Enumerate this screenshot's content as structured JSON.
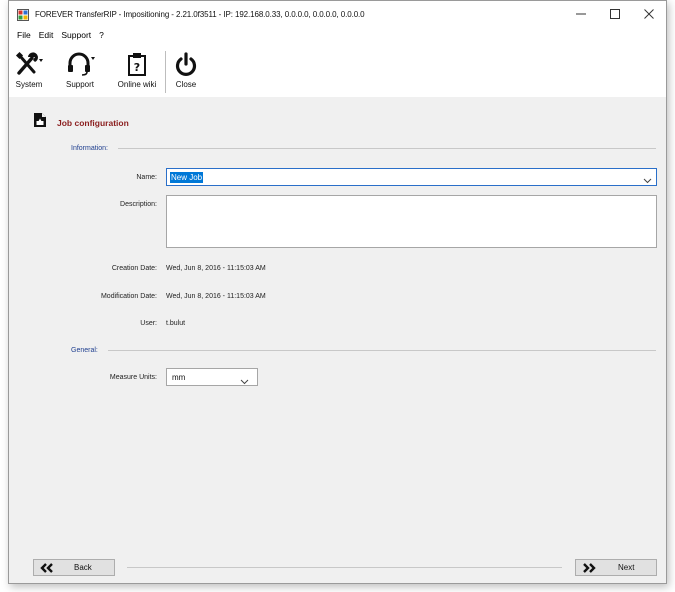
{
  "window": {
    "title": "FOREVER TransferRIP - Impositioning - 2.21.0f3511 - IP: 192.168.0.33, 0.0.0.0, 0.0.0.0, 0.0.0.0",
    "controls": {
      "minimize": "—",
      "maximize": "☐",
      "close": "✕"
    }
  },
  "menu": {
    "file": "File",
    "edit": "Edit",
    "support": "Support",
    "help": "?"
  },
  "toolbar": {
    "system": {
      "label": "System",
      "icon": "tools-icon"
    },
    "support": {
      "label": "Support",
      "icon": "headset-icon"
    },
    "online_wiki": {
      "label": "Online wiki",
      "icon": "clipboard-question-icon"
    },
    "close": {
      "label": "Close",
      "icon": "power-icon"
    }
  },
  "page": {
    "title": "Job configuration",
    "icon": "job-config-icon"
  },
  "sections": {
    "information": "Information:",
    "general": "General:"
  },
  "form": {
    "name_label": "Name:",
    "name_value": "New Job",
    "description_label": "Description:",
    "description_value": "",
    "creation_date_label": "Creation Date:",
    "creation_date_value": "Wed, Jun 8, 2016 - 11:15:03 AM",
    "modification_date_label": "Modification Date:",
    "modification_date_value": "Wed, Jun 8, 2016 - 11:15:03 AM",
    "user_label": "User:",
    "user_value": "t.bulut",
    "measure_units_label": "Measure Units:",
    "measure_units_value": "mm"
  },
  "navigation": {
    "back_label": "Back",
    "next_label": "Next"
  },
  "colors": {
    "page_title": "#8b1e1e",
    "section_label": "#1f3f8f",
    "selection": "#0078d7",
    "focus_border": "#2a6fc9"
  }
}
